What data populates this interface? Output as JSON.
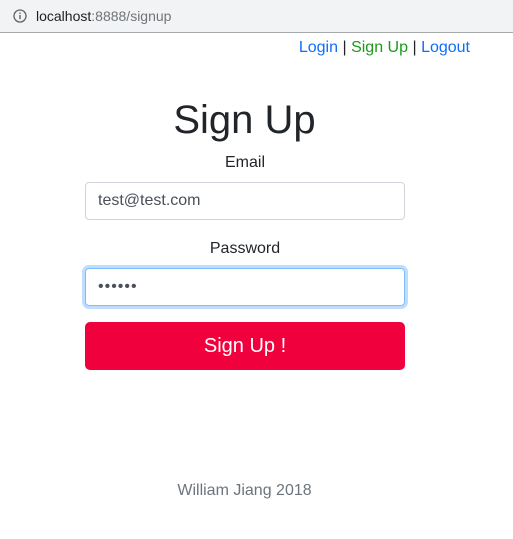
{
  "browser": {
    "url_host": "localhost",
    "url_rest": ":8888/signup",
    "icon": "info-icon"
  },
  "nav": {
    "login": "Login",
    "separator": "|",
    "signup": "Sign Up",
    "logout": "Logout"
  },
  "form": {
    "title": "Sign Up",
    "email_label": "Email",
    "email_value": "test@test.com",
    "password_label": "Password",
    "password_value": "••••••",
    "submit_label": "Sign Up !"
  },
  "footer": {
    "text": "William Jiang 2018"
  },
  "colors": {
    "link": "#0d6efd",
    "active_link": "#1a9a1a",
    "submit_bg": "#f0003c",
    "focus_border": "#80bdff"
  }
}
